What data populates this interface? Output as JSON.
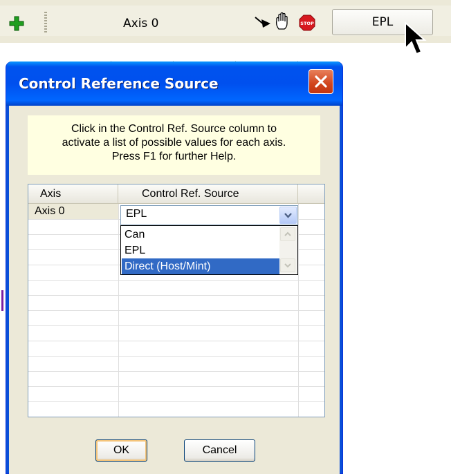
{
  "toolbar": {
    "axis_label": "Axis 0",
    "epl_button": "EPL",
    "icons": [
      "plus-icon",
      "pointer-arrow-icon",
      "hand-icon",
      "stop-icon"
    ]
  },
  "dialog": {
    "title": "Control Reference Source",
    "hint_lines": [
      "Click in the Control Ref. Source column to",
      "activate a list of possible values for each axis.",
      "Press F1 for further Help."
    ],
    "grid": {
      "headers": [
        "Axis",
        "Control Ref.  Source"
      ],
      "rows": [
        {
          "axis": "Axis 0",
          "source": "EPL"
        }
      ]
    },
    "dropdown": {
      "options": [
        "Can",
        "EPL",
        "Direct (Host/Mint)"
      ],
      "highlighted": "Direct (Host/Mint)"
    },
    "buttons": {
      "ok": "OK",
      "cancel": "Cancel"
    }
  },
  "colors": {
    "titlebar": "#0053ee",
    "hint_bg": "#ffffe1",
    "selection": "#316ac5",
    "close_button": "#d1451d",
    "dialog_face": "#ece9d8"
  }
}
